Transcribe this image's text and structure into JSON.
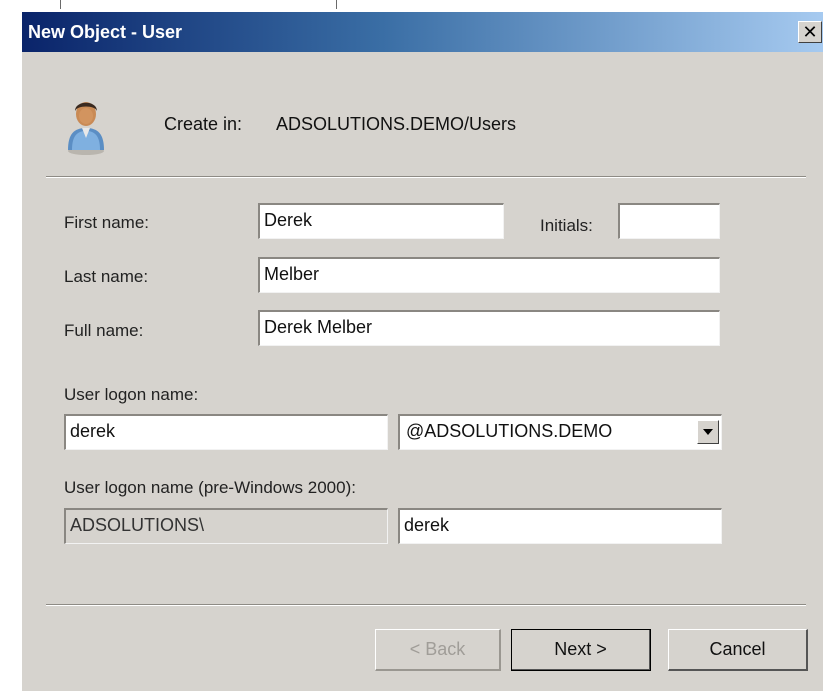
{
  "window": {
    "title": "New Object - User",
    "close_glyph": "✕"
  },
  "header": {
    "icon": "user-icon",
    "create_in_label": "Create in:",
    "create_in_path": "ADSOLUTIONS.DEMO/Users"
  },
  "form": {
    "first_name_label": "First name:",
    "first_name_value": "Derek",
    "initials_label": "Initials:",
    "initials_value": "",
    "last_name_label": "Last name:",
    "last_name_value": "Melber",
    "full_name_label": "Full name:",
    "full_name_value": "Derek Melber",
    "logon_name_label": "User logon name:",
    "logon_name_value": "derek",
    "domain_suffix_value": "@ADSOLUTIONS.DEMO",
    "pre2000_label": "User logon name (pre-Windows 2000):",
    "pre2000_domain_value": "ADSOLUTIONS\\",
    "pre2000_name_value": "derek"
  },
  "buttons": {
    "back_label": "< Back",
    "next_label": "Next >",
    "cancel_label": "Cancel"
  },
  "colors": {
    "titlebar_start": "#0a246a",
    "titlebar_end": "#a6caf0",
    "dialog_face": "#d6d3ce"
  }
}
